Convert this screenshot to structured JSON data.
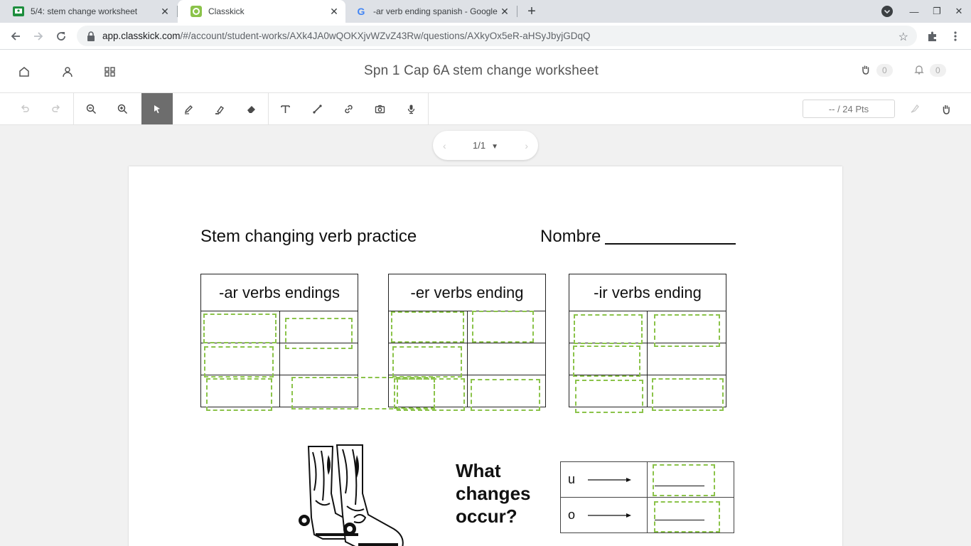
{
  "browser": {
    "tabs": [
      {
        "title": "5/4: stem change worksheet",
        "icon": "classroom-icon"
      },
      {
        "title": "Classkick",
        "icon": "classkick-icon",
        "active": true
      },
      {
        "title": "-ar verb ending spanish - Google",
        "icon": "google-icon"
      }
    ],
    "url_host": "app.classkick.com",
    "url_path": "/#/account/student-works/AXk4JA0wQOKXjvWZvZ43Rw/questions/AXkyOx5eR-aHSyJbyjGDqQ"
  },
  "app": {
    "title": "Spn 1 Cap 6A stem change worksheet",
    "help_count": "0",
    "notification_count": "0",
    "points": "-- / 24 Pts",
    "pager": "1/1"
  },
  "worksheet": {
    "title": "Stem changing verb practice",
    "nombre_label": "Nombre",
    "tables": [
      {
        "header": "-ar verbs endings"
      },
      {
        "header": "-er verbs ending"
      },
      {
        "header": "-ir verbs ending"
      }
    ],
    "question": {
      "line1": "What",
      "line2": "changes",
      "line3": "occur?"
    },
    "changes": [
      {
        "from": "u"
      },
      {
        "from": "o"
      }
    ]
  },
  "colors": {
    "dropzone": "#8bc34a",
    "selected_tool": "#6d6d6d"
  }
}
